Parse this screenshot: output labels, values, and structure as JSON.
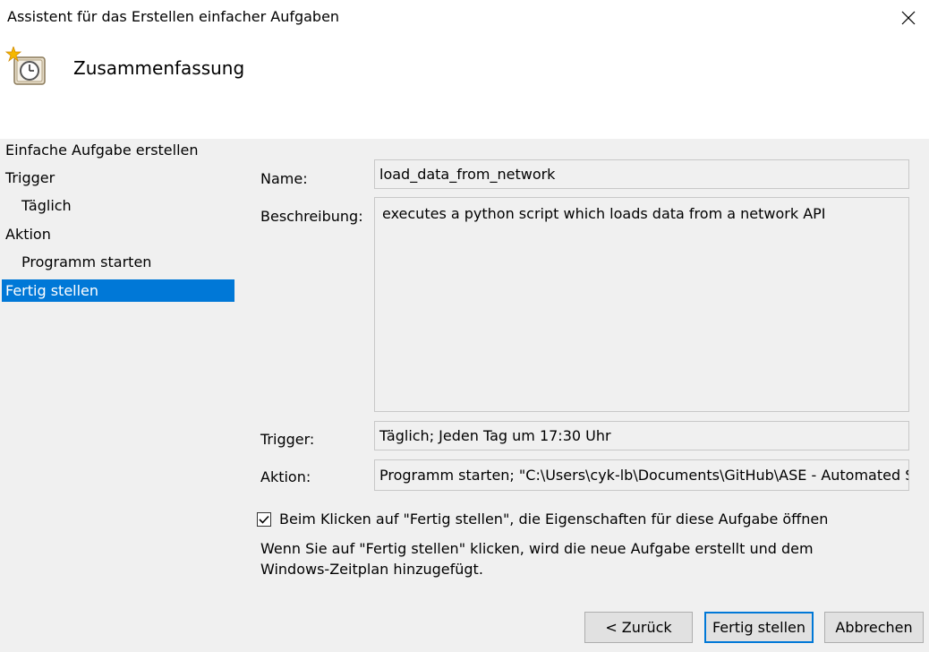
{
  "window": {
    "title": "Assistent für das Erstellen einfacher Aufgaben",
    "close_icon": "close-icon"
  },
  "header": {
    "title": "Zusammenfassung",
    "icon": "task-clock-icon"
  },
  "steps": [
    {
      "label": "Einfache Aufgabe erstellen",
      "level": 0,
      "active": false
    },
    {
      "label": "Trigger",
      "level": 0,
      "active": false
    },
    {
      "label": "Täglich",
      "level": 1,
      "active": false
    },
    {
      "label": "Aktion",
      "level": 0,
      "active": false
    },
    {
      "label": "Programm starten",
      "level": 1,
      "active": false
    },
    {
      "label": "Fertig stellen",
      "level": 0,
      "active": true
    }
  ],
  "summary": {
    "name_label": "Name:",
    "name_value": "load_data_from_network",
    "description_label": "Beschreibung:",
    "description_value": "executes a python script which loads data from a network API",
    "trigger_label": "Trigger:",
    "trigger_value": "Täglich; Jeden Tag um 17:30 Uhr",
    "action_label": "Aktion:",
    "action_value": "Programm starten; \"C:\\Users\\cyk-lb\\Documents\\GitHub\\ASE - Automated Scr"
  },
  "open_properties": {
    "label": "Beim Klicken auf \"Fertig stellen\", die Eigenschaften für diese Aufgabe öffnen",
    "checked": true
  },
  "info_text": {
    "line1": "Wenn Sie auf \"Fertig stellen\" klicken, wird die neue Aufgabe erstellt und dem",
    "line2": "Windows-Zeitplan hinzugefügt."
  },
  "buttons": {
    "back": "< Zurück",
    "finish": "Fertig stellen",
    "cancel": "Abbrechen"
  },
  "colors": {
    "selection": "#0078d7",
    "panel_background": "#f0f0f0",
    "header_background": "#ffffff"
  }
}
